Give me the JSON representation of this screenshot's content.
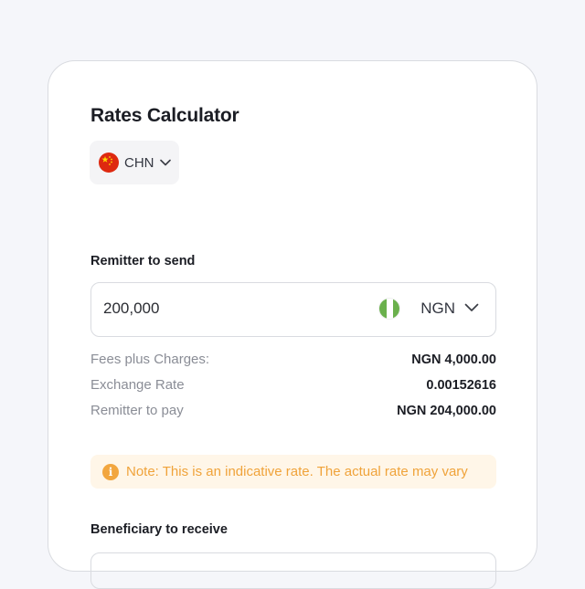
{
  "calculator": {
    "title": "Rates Calculator",
    "country": {
      "code": "CHN",
      "flag_icon": "china-flag-icon"
    },
    "send": {
      "label": "Remitter to send",
      "amount": "200,000",
      "currency": "NGN",
      "currency_flag_icon": "nigeria-flag-icon"
    },
    "summary": [
      {
        "key": "Fees plus Charges:",
        "value": "NGN 4,000.00"
      },
      {
        "key": "Exchange Rate",
        "value": "0.00152616"
      },
      {
        "key": "Remitter to pay",
        "value": "NGN 204,000.00"
      }
    ],
    "note": {
      "icon": "info-icon",
      "text": "Note: This is an indicative rate. The actual rate may vary"
    },
    "receive": {
      "label": "Beneficiary to receive"
    }
  },
  "colors": {
    "background": "#f5f6fa",
    "note_bg": "#fff6e8",
    "note_text": "#f0a33a",
    "china_red": "#de2910",
    "nigeria_green": "#6ab04c"
  }
}
